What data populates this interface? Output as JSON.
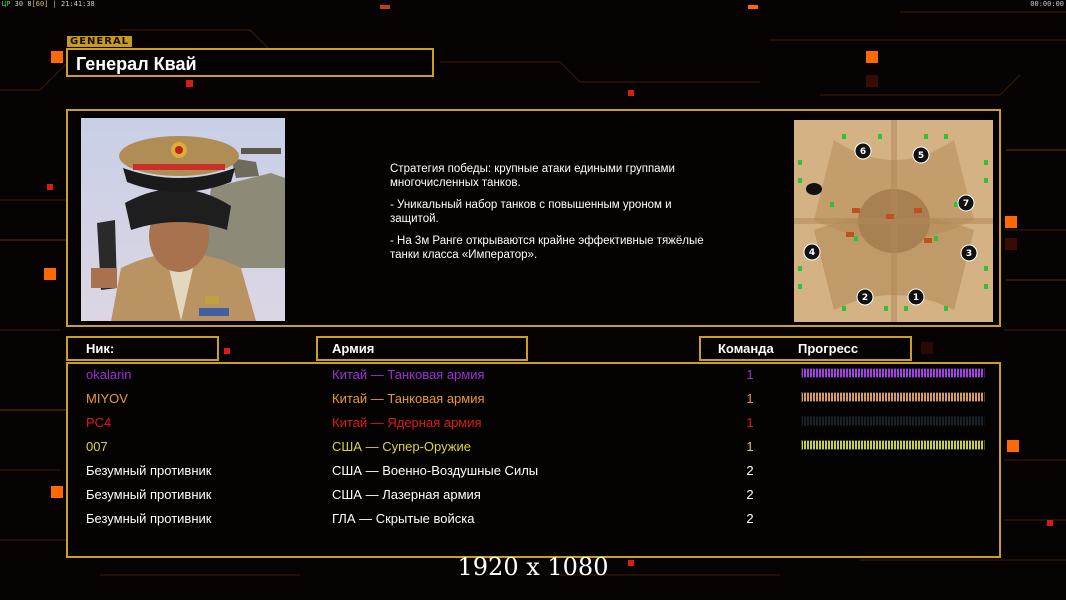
{
  "topbar": {
    "left_prefix": "ЦР",
    "left_nums": "30",
    "left_num2": "8",
    "left_bracket": "[60]",
    "clock": "21:41:38",
    "right_clock": "00:00:00"
  },
  "general": {
    "tag": "GENERAL",
    "name": "Генерал Квай"
  },
  "description": [
    "Стратегия победы: крупные атаки едиными группами многочисленных танков.",
    "- Уникальный набор танков с повышенным уроном и защитой.",
    "- На 3м Ранге открываются крайне эффективные тяжёлые танки класса «Император»."
  ],
  "table_headers": {
    "nick": "Ник:",
    "army": "Армия",
    "team": "Команда",
    "progress": "Прогресс"
  },
  "players": [
    {
      "nick": "okalarin",
      "army": "Китай — Танковая армия",
      "team": "1",
      "color": "#9b2fd8",
      "progress": 1.0,
      "bar_color": "#a040e0"
    },
    {
      "nick": "MIYOV",
      "army": "Китай — Танковая армия",
      "team": "1",
      "color": "#e89a30",
      "progress": 1.0,
      "bar_color": "#d89b5a"
    },
    {
      "nick": "PC4",
      "army": "Китай — Ядерная армия",
      "team": "1",
      "color": "#e01818",
      "progress": 1.0,
      "bar_color": "#1c2228"
    },
    {
      "nick": "007",
      "army": "США — Супер-Оружие",
      "team": "1",
      "color": "#d8d43a",
      "progress": 1.0,
      "bar_color": "#c8d040"
    },
    {
      "nick": "Безумный противник",
      "army": "США — Военно-Воздушные Силы",
      "team": "2",
      "color": "#ffffff"
    },
    {
      "nick": "Безумный противник",
      "army": "США — Лазерная армия",
      "team": "2",
      "color": "#ffffff"
    },
    {
      "nick": "Безумный противник",
      "army": "ГЛА — Скрытые войска",
      "team": "2",
      "color": "#ffffff"
    }
  ],
  "minimap_slots": [
    "6",
    "5",
    "7",
    "4",
    "3",
    "2",
    "1"
  ],
  "resolution": "1920 x 1080",
  "colors": {
    "accent": "#c9a020",
    "orange": "#ff6a00"
  }
}
